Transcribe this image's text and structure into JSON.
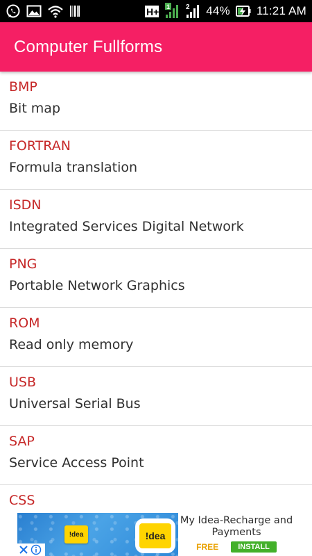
{
  "status_bar": {
    "battery_percent": "44%",
    "time": "11:21 AM",
    "network_type": "H+",
    "sim2_label": "2",
    "left_icons": [
      "whatsapp-icon",
      "image-icon",
      "wifi-icon",
      "barcode-icon"
    ],
    "right_icons": [
      "network-type-icon",
      "signal-sim1-icon",
      "signal-sim2-icon",
      "battery-charging-icon"
    ]
  },
  "app_bar": {
    "title": "Computer Fullforms",
    "color": "#f51f64"
  },
  "list": {
    "items": [
      {
        "abbr": "BMP",
        "full": "Bit map"
      },
      {
        "abbr": "FORTRAN",
        "full": "Formula translation"
      },
      {
        "abbr": "ISDN",
        "full": "Integrated Services Digital Network"
      },
      {
        "abbr": "PNG",
        "full": "Portable Network Graphics"
      },
      {
        "abbr": "ROM",
        "full": "Read only memory"
      },
      {
        "abbr": "USB",
        "full": "Universal Serial Bus"
      },
      {
        "abbr": "SAP",
        "full": "Service Access Point"
      },
      {
        "abbr": "CSS",
        "full": ""
      }
    ],
    "abbr_color": "#c62828"
  },
  "ad": {
    "logo_text": "!dea",
    "title": "My Idea-Recharge and Payments",
    "price": "FREE",
    "install_label": "INSTALL",
    "install_color": "#43b02a",
    "close_icon": "close-icon",
    "info_icon": "info-icon"
  }
}
